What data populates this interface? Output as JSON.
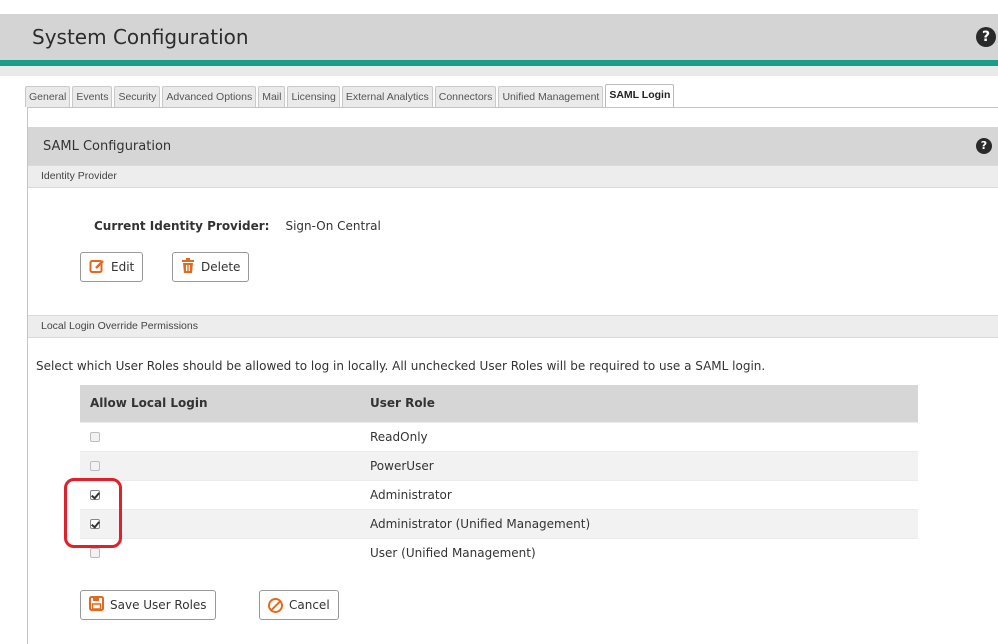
{
  "app": {
    "title": "System Configuration",
    "help_glyph": "?"
  },
  "tabs": [
    {
      "label": "General",
      "active": false
    },
    {
      "label": "Events",
      "active": false
    },
    {
      "label": "Security",
      "active": false
    },
    {
      "label": "Advanced Options",
      "active": false
    },
    {
      "label": "Mail",
      "active": false
    },
    {
      "label": "Licensing",
      "active": false
    },
    {
      "label": "External Analytics",
      "active": false
    },
    {
      "label": "Connectors",
      "active": false
    },
    {
      "label": "Unified Management",
      "active": false
    },
    {
      "label": "SAML Login",
      "active": true
    }
  ],
  "panel": {
    "title": "SAML Configuration",
    "help_glyph": "?"
  },
  "identity_provider": {
    "section_title": "Identity Provider",
    "label": "Current Identity Provider:",
    "value": "Sign-On Central",
    "edit_label": "Edit",
    "delete_label": "Delete"
  },
  "local_login": {
    "section_title": "Local Login Override Permissions",
    "description": "Select which User Roles should be allowed to log in locally. All unchecked User Roles will be required to use a SAML login.",
    "columns": [
      "Allow Local Login",
      "User Role"
    ],
    "rows": [
      {
        "role": "ReadOnly",
        "checked": false
      },
      {
        "role": "PowerUser",
        "checked": false
      },
      {
        "role": "Administrator",
        "checked": true
      },
      {
        "role": "Administrator (Unified Management)",
        "checked": true
      },
      {
        "role": "User (Unified Management)",
        "checked": false
      }
    ],
    "save_label": "Save User Roles",
    "cancel_label": "Cancel"
  },
  "colors": {
    "accent": "#1a9d8a",
    "button_icon": "#e26a1f",
    "highlight": "#e0202a"
  }
}
